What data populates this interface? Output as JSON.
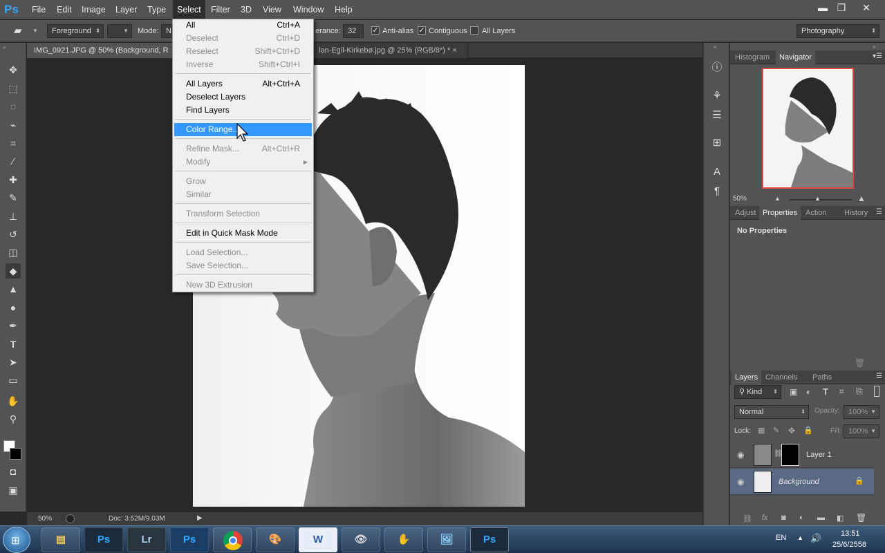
{
  "app": {
    "logo": "Ps"
  },
  "menubar": {
    "items": [
      "File",
      "Edit",
      "Image",
      "Layer",
      "Type",
      "Select",
      "Filter",
      "3D",
      "View",
      "Window",
      "Help"
    ],
    "active": "Select"
  },
  "window_controls": {
    "minimize": "▬",
    "restore": "❐",
    "close": "✕"
  },
  "options": {
    "fill_source": "Foreground",
    "mode_label": "Mode:",
    "mode_value": "N",
    "tolerance_label": "erance:",
    "tolerance_value": "32",
    "anti_alias": "Anti-alias",
    "contiguous": "Contiguous",
    "all_layers": "All Layers",
    "workspace": "Photography"
  },
  "tabs": [
    {
      "label": "IMG_0921.JPG @ 50% (Background, R"
    },
    {
      "label": "lan-Egil-Kirkebø.jpg @ 25% (RGB/8*) *",
      "close": "×"
    }
  ],
  "select_menu": {
    "groups": [
      [
        {
          "label": "All",
          "shortcut": "Ctrl+A",
          "enabled": true
        },
        {
          "label": "Deselect",
          "shortcut": "Ctrl+D",
          "enabled": false
        },
        {
          "label": "Reselect",
          "shortcut": "Shift+Ctrl+D",
          "enabled": false
        },
        {
          "label": "Inverse",
          "shortcut": "Shift+Ctrl+I",
          "enabled": false
        }
      ],
      [
        {
          "label": "All Layers",
          "shortcut": "Alt+Ctrl+A",
          "enabled": true
        },
        {
          "label": "Deselect Layers",
          "shortcut": "",
          "enabled": true
        },
        {
          "label": "Find Layers",
          "shortcut": "",
          "enabled": true
        }
      ],
      [
        {
          "label": "Color Range...",
          "shortcut": "",
          "enabled": true,
          "highlighted": true
        }
      ],
      [
        {
          "label": "Refine Mask...",
          "shortcut": "Alt+Ctrl+R",
          "enabled": false
        },
        {
          "label": "Modify",
          "shortcut": "",
          "enabled": false,
          "submenu": true
        }
      ],
      [
        {
          "label": "Grow",
          "shortcut": "",
          "enabled": false
        },
        {
          "label": "Similar",
          "shortcut": "",
          "enabled": false
        }
      ],
      [
        {
          "label": "Transform Selection",
          "shortcut": "",
          "enabled": false
        }
      ],
      [
        {
          "label": "Edit in Quick Mask Mode",
          "shortcut": "",
          "enabled": true
        }
      ],
      [
        {
          "label": "Load Selection...",
          "shortcut": "",
          "enabled": false
        },
        {
          "label": "Save Selection...",
          "shortcut": "",
          "enabled": false
        }
      ],
      [
        {
          "label": "New 3D Extrusion",
          "shortcut": "",
          "enabled": false
        }
      ]
    ]
  },
  "status": {
    "zoom": "50%",
    "doc": "Doc: 3.52M/9.03M"
  },
  "navigator": {
    "tabs": [
      "Histogram",
      "Navigator"
    ],
    "active": "Navigator",
    "zoom": "50%"
  },
  "properties": {
    "tabs": [
      "Adjust",
      "Properties",
      "Action",
      "History"
    ],
    "active": "Properties",
    "message": "No Properties"
  },
  "layers_panel": {
    "tabs": [
      "Layers",
      "Channels",
      "Paths"
    ],
    "active": "Layers",
    "filter_kind": "Kind",
    "blend_mode": "Normal",
    "opacity_label": "Opacity:",
    "opacity_value": "100%",
    "lock_label": "Lock:",
    "fill_label": "Fill:",
    "fill_value": "100%",
    "layers": [
      {
        "name": "Layer 1",
        "selected": false,
        "italic": false
      },
      {
        "name": "Background",
        "selected": true,
        "italic": true
      }
    ]
  },
  "taskbar": {
    "apps": [
      "Ps",
      "Lr",
      "Ps"
    ],
    "language": "EN",
    "time": "13:51",
    "date": "25/6/2558"
  },
  "colors": {
    "menu_highlight": "#3399ff",
    "ps_blue": "#31a8ff",
    "lr_blue": "#add5ec"
  }
}
